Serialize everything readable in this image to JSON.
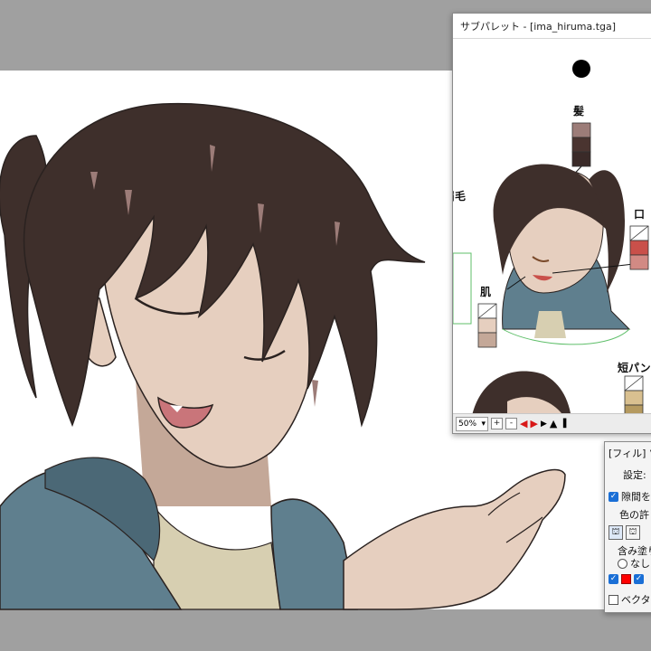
{
  "canvas": {
    "background": "#a0a0a0",
    "sheet_color": "#ffffff"
  },
  "colors": {
    "hair": "#3e2f2b",
    "skin": "#e6cfbf",
    "skin_shadow": "#c4a898",
    "jacket": "#5f7f8e",
    "jacket_shadow": "#4b6876",
    "shirt": "#d7cfb1",
    "mouth": "#c9757a",
    "line": "#2a2220"
  },
  "subpalette": {
    "title": "サブパレット - [ima_hiruma.tga]",
    "labels": {
      "hair": "髪",
      "eyebrow": "眉毛",
      "mouth": "口",
      "skin": "肌",
      "shorts": "短パン"
    },
    "hair_swatches": [
      "#9c7c78",
      "#4a3430",
      "#3a2a28"
    ],
    "mouth_swatches": [
      "#ffffff",
      "#c9504a",
      "#d28a84"
    ],
    "skin_swatches": [
      "#ffffff",
      "#e6cfbf",
      "#c4a898"
    ],
    "shorts_swatches": [
      "#ffffff",
      "#d9c090",
      "#b59a60"
    ],
    "toolbar": {
      "zoom": "50%",
      "zoom_in": "+",
      "zoom_out": "-"
    }
  },
  "fill_panel": {
    "title": "[フィル] ツー",
    "settings": "設定:",
    "gap_close": "隙間を閉",
    "color_tol": "色の許",
    "include_fill": "含み塗り",
    "none": "なし",
    "vector": "ベクタ"
  }
}
